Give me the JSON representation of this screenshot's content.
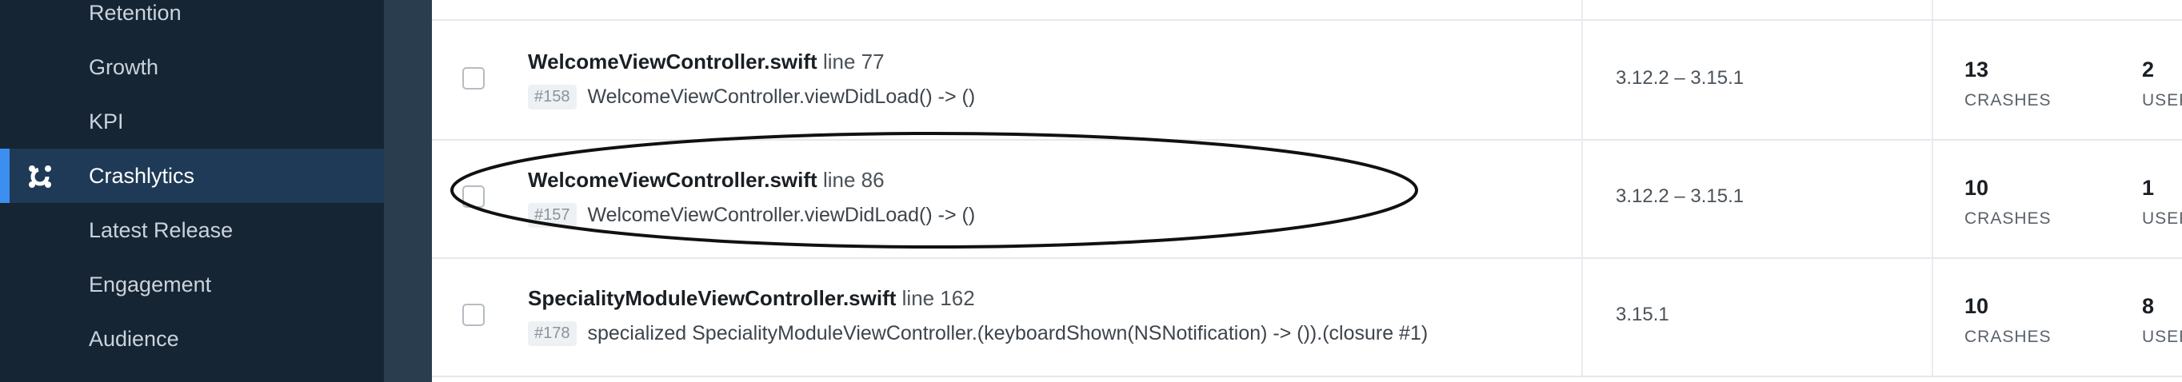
{
  "sidebar": {
    "items": [
      {
        "label": "Retention"
      },
      {
        "label": "Growth"
      },
      {
        "label": "KPI"
      },
      {
        "label": "Crashlytics",
        "active": true,
        "icon": "crashlytics-icon"
      },
      {
        "label": "Latest Release"
      },
      {
        "label": "Engagement"
      },
      {
        "label": "Audience"
      }
    ]
  },
  "issues": [
    {
      "file": "WelcomeViewController.swift",
      "line": "line 77",
      "number": "#158",
      "method": "WelcomeViewController.viewDidLoad() -> ()",
      "versions": "3.12.2 – 3.15.1",
      "crashes": "13",
      "crashes_label": "CRASHES",
      "users": "2",
      "users_label": "USERS"
    },
    {
      "file": "WelcomeViewController.swift",
      "line": "line 86",
      "number": "#157",
      "method": "WelcomeViewController.viewDidLoad() -> ()",
      "versions": "3.12.2 – 3.15.1",
      "crashes": "10",
      "crashes_label": "CRASHES",
      "users": "1",
      "users_label": "USERS"
    },
    {
      "file": "SpecialityModuleViewController.swift",
      "line": "line 162",
      "number": "#178",
      "method": "specialized SpecialityModuleViewController.(keyboardShown(NSNotification) -> ()).(closure #1)",
      "versions": "3.15.1",
      "crashes": "10",
      "crashes_label": "CRASHES",
      "users": "8",
      "users_label": "USERS"
    }
  ],
  "colors": {
    "sidebar_bg": "#162533",
    "sidebar_active_bg": "#1f3a56",
    "accent": "#3c8ff0"
  }
}
